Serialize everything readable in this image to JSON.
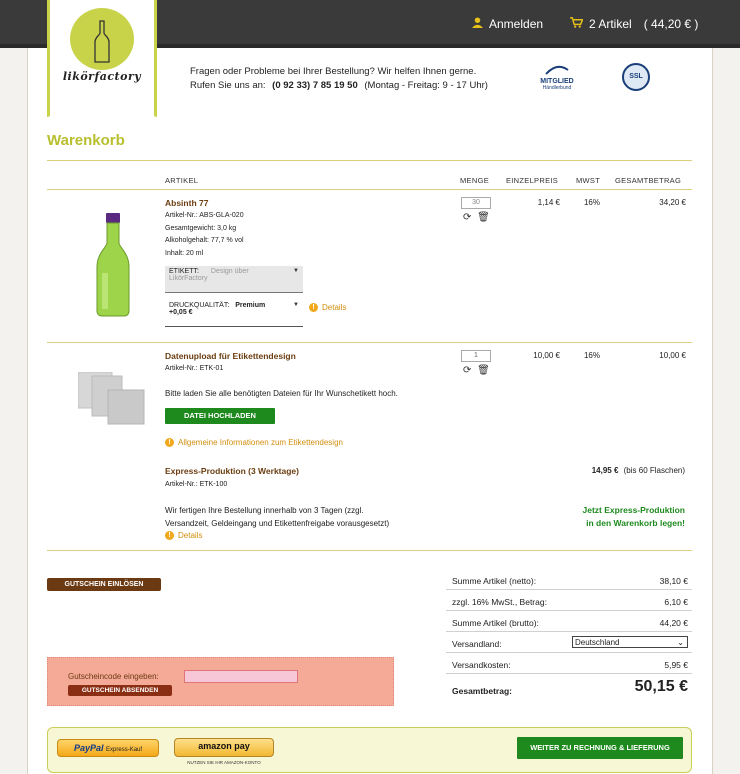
{
  "header": {
    "login_label": "Anmelden",
    "cart_label": "2 Artikel",
    "cart_total": "( 44,20 € )",
    "logo_text": "likörfactory",
    "help_line1": "Fragen oder Probleme bei Ihrer Bestellung? Wir helfen Ihnen gerne.",
    "help_line2_prefix": "Rufen Sie uns an:",
    "help_phone": "(0 92 33) 7 85 19 50",
    "help_hours": "(Montag - Freitag: 9 - 17 Uhr)",
    "badge_mitglied": "MITGLIED",
    "badge_mitglied_sub": "Händlerbund",
    "badge_ssl": "SSL"
  },
  "page_title": "Warenkorb",
  "table_headers": {
    "article": "ARTIKEL",
    "qty": "MENGE",
    "unit_price": "EINZELPREIS",
    "vat": "MWST",
    "total": "GESAMTBETRAG"
  },
  "items": [
    {
      "name": "Absinth 77",
      "details": [
        "Artikel-Nr.: ABS-GLA-020",
        "Gesamtgewicht: 3,0 kg",
        "Alkoholgehalt: 77,7 % vol",
        "Inhalt: 20 ml"
      ],
      "qty": "30",
      "unit_price": "1,14 €",
      "vat": "16%",
      "total": "34,20 €",
      "etikett_key": "ETIKETT:",
      "etikett_value": "Design über",
      "etikett_value2": "LikörFactory",
      "druck_key": "DRUCKQUALITÄT:",
      "druck_value": "Premium",
      "druck_price": "+0,05 €",
      "details_link": "Details"
    },
    {
      "name": "Datenupload für Etikettendesign",
      "details": [
        "Artikel-Nr.: ETK-01"
      ],
      "qty": "1",
      "unit_price": "10,00 €",
      "vat": "16%",
      "total": "10,00 €",
      "upload_text": "Bitte laden Sie alle benötigten Dateien für Ihr Wunschetikett hoch.",
      "upload_button": "DATEI HOCHLADEN",
      "info_link": "Allgemeine Informationen zum Etikettendesign"
    }
  ],
  "express": {
    "name": "Express-Produktion (3 Werktage)",
    "article_no": "Artikel-Nr.: ETK-100",
    "price": "14,95 €",
    "price_note": "(bis 60 Flaschen)",
    "desc1": "Wir fertigen Ihre Bestellung innerhalb von 3 Tagen (zzgl.",
    "desc2": "Versandzeit, Geldeingang und Etikettenfreigabe vorausgesetzt)",
    "details_link": "Details",
    "cta1": "Jetzt Express-Produktion",
    "cta2": "in den Warenkorb legen!"
  },
  "voucher": {
    "redeem_button": "GUTSCHEIN EINLÖSEN",
    "label": "Gutscheincode eingeben:",
    "input_value": "",
    "submit_button": "GUTSCHEIN ABSENDEN"
  },
  "summary": {
    "net_label": "Summe Artikel (netto):",
    "net_value": "38,10 €",
    "vat_label": "zzgl. 16% MwSt., Betrag:",
    "vat_value": "6,10 €",
    "gross_label": "Summe Artikel (brutto):",
    "gross_value": "44,20 €",
    "country_label": "Versandland:",
    "country_value": "Deutschland",
    "shipping_label": "Versandkosten:",
    "shipping_value": "5,95 €",
    "total_label": "Gesamtbetrag:",
    "total_value": "50,15 €"
  },
  "payment": {
    "paypal": "PayPal",
    "paypal_sub": "Express-Kauf",
    "amazon": "amazon pay",
    "amazon_sub": "NUTZEN SIE IHR AMAZON-KONTO",
    "checkout_button": "WEITER ZU RECHNUNG & LIEFERUNG"
  },
  "colors": {
    "accent": "#c9d34a",
    "brand_brown": "#6b3a12",
    "green": "#1e8a1e",
    "info_orange": "#f0a81c"
  }
}
